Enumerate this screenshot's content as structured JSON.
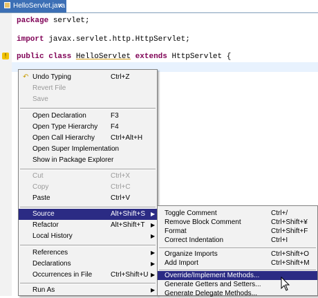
{
  "editor": {
    "tab_title": "HelloServlet.java",
    "lines": [
      {
        "keyword": "package",
        "rest": " servlet;"
      },
      {
        "keyword": "import",
        "rest": " javax.servlet.http.HttpServlet;"
      },
      {
        "kw1": "public",
        "kw2": "class",
        "classname": "HelloServlet",
        "kw3": "extends",
        "rest": " HttpServlet {"
      }
    ]
  },
  "context_menu": {
    "items": [
      {
        "label": "Undo Typing",
        "accel": "Ctrl+Z",
        "enabled": true
      },
      {
        "label": "Revert File",
        "accel": "",
        "enabled": false
      },
      {
        "label": "Save",
        "accel": "",
        "enabled": false
      },
      {
        "label": "Open Declaration",
        "accel": "F3",
        "enabled": true
      },
      {
        "label": "Open Type Hierarchy",
        "accel": "F4",
        "enabled": true
      },
      {
        "label": "Open Call Hierarchy",
        "accel": "Ctrl+Alt+H",
        "enabled": true
      },
      {
        "label": "Open Super Implementation",
        "accel": "",
        "enabled": true
      },
      {
        "label": "Show in Package Explorer",
        "accel": "",
        "enabled": true
      },
      {
        "label": "Cut",
        "accel": "Ctrl+X",
        "enabled": false
      },
      {
        "label": "Copy",
        "accel": "Ctrl+C",
        "enabled": false
      },
      {
        "label": "Paste",
        "accel": "Ctrl+V",
        "enabled": true
      },
      {
        "label": "Source",
        "accel": "Alt+Shift+S",
        "enabled": true,
        "submenu": true,
        "selected": true
      },
      {
        "label": "Refactor",
        "accel": "Alt+Shift+T",
        "enabled": true,
        "submenu": true
      },
      {
        "label": "Local History",
        "accel": "",
        "enabled": true,
        "submenu": true
      },
      {
        "label": "References",
        "accel": "",
        "enabled": true,
        "submenu": true
      },
      {
        "label": "Declarations",
        "accel": "",
        "enabled": true,
        "submenu": true
      },
      {
        "label": "Occurrences in File",
        "accel": "Ctrl+Shift+U",
        "enabled": true,
        "submenu": true
      },
      {
        "label": "Run As",
        "accel": "",
        "enabled": true,
        "submenu": true
      }
    ]
  },
  "source_submenu": {
    "items": [
      {
        "label": "Toggle Comment",
        "accel": "Ctrl+/"
      },
      {
        "label": "Remove Block Comment",
        "accel": "Ctrl+Shift+¥"
      },
      {
        "label": "Format",
        "accel": "Ctrl+Shift+F"
      },
      {
        "label": "Correct Indentation",
        "accel": "Ctrl+I"
      },
      {
        "label": "Organize Imports",
        "accel": "Ctrl+Shift+O"
      },
      {
        "label": "Add Import",
        "accel": "Ctrl+Shift+M"
      },
      {
        "label": "Override/Implement Methods...",
        "accel": "",
        "selected": true
      },
      {
        "label": "Generate Getters and Setters...",
        "accel": ""
      },
      {
        "label": "Generate Delegate Methods...",
        "accel": ""
      }
    ]
  },
  "colors": {
    "highlight": "#2b2b84",
    "keyword": "#7f0055",
    "tab": "#3c6fb5"
  }
}
